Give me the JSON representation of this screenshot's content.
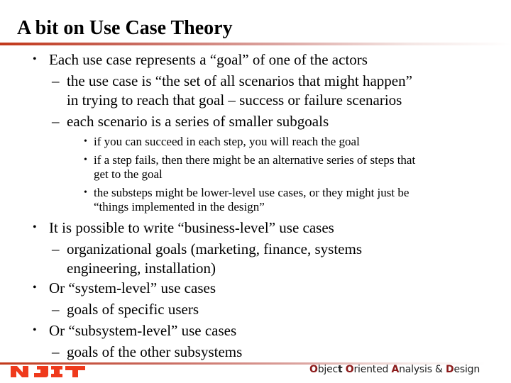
{
  "slide": {
    "title": "A bit on Use Case Theory",
    "bullet_glyph": "•",
    "dash_glyph": "–",
    "lines": [
      {
        "level": 1,
        "marker": true,
        "text": "Each use case represents a “goal” of one of the actors"
      },
      {
        "level": 2,
        "marker": true,
        "text": "the use case is “the set of all scenarios that might happen”"
      },
      {
        "level": 2,
        "marker": false,
        "text": "in trying to reach that goal – success or failure scenarios"
      },
      {
        "level": 2,
        "marker": true,
        "text": "each scenario is a series of smaller subgoals"
      },
      {
        "level": 3,
        "marker": true,
        "text": "if you can succeed in each step, you will reach the goal"
      },
      {
        "level": 3,
        "marker": true,
        "text": "if a step fails, then there might be an alternative series of steps that"
      },
      {
        "level": 3,
        "marker": false,
        "text": "get to the goal"
      },
      {
        "level": 3,
        "marker": true,
        "text": "the substeps might be lower-level use cases, or they might just be"
      },
      {
        "level": 3,
        "marker": false,
        "text": "“things implemented in the design”"
      },
      {
        "level": 1,
        "marker": true,
        "text": "It is possible to write “business-level” use cases"
      },
      {
        "level": 2,
        "marker": true,
        "text": "organizational goals (marketing, finance, systems"
      },
      {
        "level": 2,
        "marker": false,
        "text": "engineering, installation)"
      },
      {
        "level": 1,
        "marker": true,
        "text": "Or “system-level” use cases"
      },
      {
        "level": 2,
        "marker": true,
        "text": "goals of specific users"
      },
      {
        "level": 1,
        "marker": true,
        "text": "Or “subsystem-level” use cases"
      },
      {
        "level": 2,
        "marker": true,
        "text": "goals of the other subsystems"
      }
    ]
  },
  "footer": {
    "logo_text": "NJIT",
    "course_parts": [
      {
        "text": "O",
        "style": "hl"
      },
      {
        "text": "bjec",
        "style": ""
      },
      {
        "text": "t",
        "style": "bd"
      },
      {
        "text": " ",
        "style": ""
      },
      {
        "text": "O",
        "style": "hl"
      },
      {
        "text": "riented ",
        "style": ""
      },
      {
        "text": "A",
        "style": "hl"
      },
      {
        "text": "nalysis & ",
        "style": ""
      },
      {
        "text": "D",
        "style": "hl"
      },
      {
        "text": "esign",
        "style": ""
      }
    ]
  },
  "colors": {
    "accent_red": "#c2381a",
    "logo_red": "#ef3a1c",
    "footer_highlight": "#8b1a1a"
  }
}
